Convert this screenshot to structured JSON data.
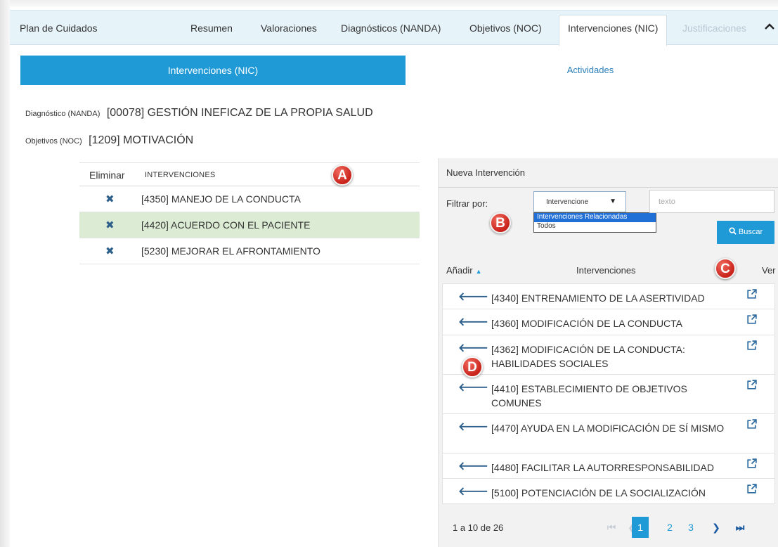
{
  "tabs": {
    "title": "Plan de Cuidados",
    "items": [
      "Resumen",
      "Valoraciones",
      "Diagnósticos (NANDA)",
      "Objetivos (NOC)",
      "Intervenciones (NIC)",
      "Justificaciones"
    ],
    "active": "Intervenciones (NIC)"
  },
  "subtabs": {
    "left": "Intervenciones (NIC)",
    "right": "Actividades"
  },
  "diagnostico": {
    "label": "Diagnóstico (NANDA)",
    "value": "[00078] GESTIÓN INEFICAZ DE LA PROPIA SALUD"
  },
  "objetivos": {
    "label": "Objetivos (NOC)",
    "value": "[1209] MOTIVACIÓN"
  },
  "left_table": {
    "headers": {
      "eliminar": "Eliminar",
      "intervenciones": "INTERVENCIONES"
    },
    "rows": [
      {
        "text": "[4350] MANEJO DE LA CONDUCTA",
        "selected": false
      },
      {
        "text": "[4420] ACUERDO CON EL PACIENTE",
        "selected": true
      },
      {
        "text": "[5230] MEJORAR EL AFRONTAMIENTO",
        "selected": false
      }
    ]
  },
  "new_intervention": {
    "title": "Nueva Intervención",
    "filter_label": "Filtrar por:",
    "select_value": "Intervencione",
    "options": [
      "Intervenciones Relacionadas",
      "Todos"
    ],
    "text_placeholder": "texto",
    "search_button": "Buscar",
    "headers": {
      "add": "Añadir",
      "name": "Intervenciones",
      "view": "Ver"
    },
    "rows": [
      "[4340] ENTRENAMIENTO DE LA ASERTIVIDAD",
      "[4360] MODIFICACIÓN DE LA CONDUCTA",
      "[4362] MODIFICACIÓN DE LA CONDUCTA: HABILIDADES SOCIALES",
      "[4410] ESTABLECIMIENTO DE OBJETIVOS COMUNES",
      "[4470] AYUDA EN LA MODIFICACIÓN DE SÍ MISMO",
      "[4480] FACILITAR LA AUTORRESPONSABILIDAD",
      "[5100] POTENCIACIÓN DE LA SOCIALIZACIÓN"
    ],
    "pagination": {
      "info": "1 a 10 de 26",
      "pages": [
        "1",
        "2",
        "3"
      ],
      "current": "1"
    }
  },
  "markers": [
    "A",
    "B",
    "C",
    "D"
  ],
  "colors": {
    "accent": "#1f9ad6",
    "selected_row": "#dcebd3",
    "icon": "#2c5f8a",
    "marker": "#d9342b"
  },
  "icons": {
    "remove": "times-icon",
    "add": "arrow-left-icon",
    "view": "external-link-icon",
    "sort": "sort-icon"
  }
}
